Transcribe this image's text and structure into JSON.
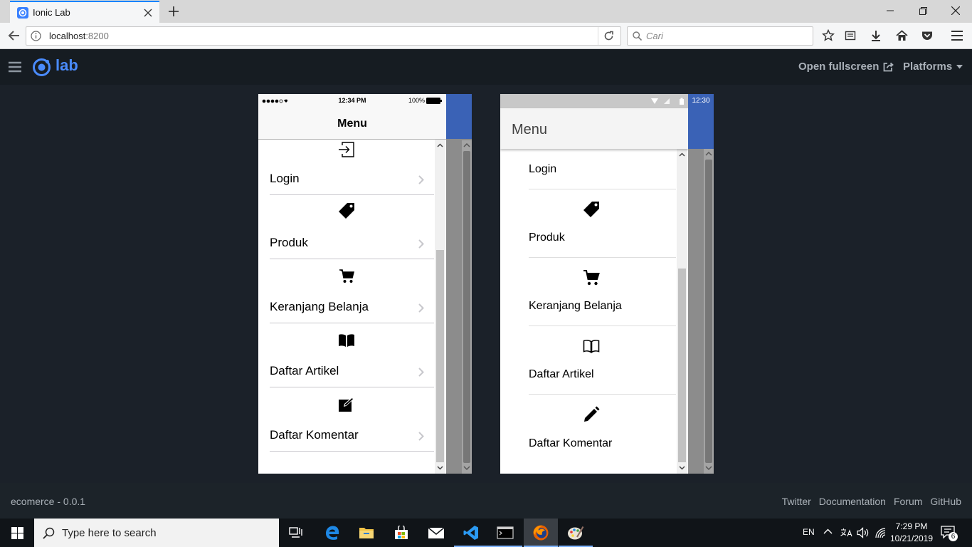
{
  "browser": {
    "tab_title": "Ionic Lab",
    "url_host": "localhost",
    "url_port": ":8200",
    "search_placeholder": "Cari"
  },
  "lab": {
    "logo_text": "lab",
    "open_fullscreen": "Open fullscreen",
    "platforms": "Platforms",
    "accent": "#4a8bfc"
  },
  "ios": {
    "status_time": "12:34 PM",
    "battery": "100%",
    "title": "Menu",
    "items": [
      {
        "label": "Login",
        "icon": "log-in-icon"
      },
      {
        "label": "Produk",
        "icon": "pricetag-icon"
      },
      {
        "label": "Keranjang Belanja",
        "icon": "cart-icon"
      },
      {
        "label": "Daftar Artikel",
        "icon": "book-icon"
      },
      {
        "label": "Daftar Komentar",
        "icon": "create-icon"
      }
    ]
  },
  "android": {
    "status_time": "12:30",
    "title": "Menu",
    "items": [
      {
        "label": "Login"
      },
      {
        "label": "Produk",
        "icon": "pricetag-icon"
      },
      {
        "label": "Keranjang Belanja",
        "icon": "cart-icon"
      },
      {
        "label": "Daftar Artikel",
        "icon": "book-outline-icon"
      },
      {
        "label": "Daftar Komentar",
        "icon": "pencil-icon"
      }
    ]
  },
  "footer": {
    "version": "ecomerce - 0.0.1",
    "links": [
      "Twitter",
      "Documentation",
      "Forum",
      "GitHub"
    ]
  },
  "taskbar": {
    "search_placeholder": "Type here to search",
    "language": "EN",
    "time": "7:29 PM",
    "date": "10/21/2019",
    "notification_count": "6"
  }
}
